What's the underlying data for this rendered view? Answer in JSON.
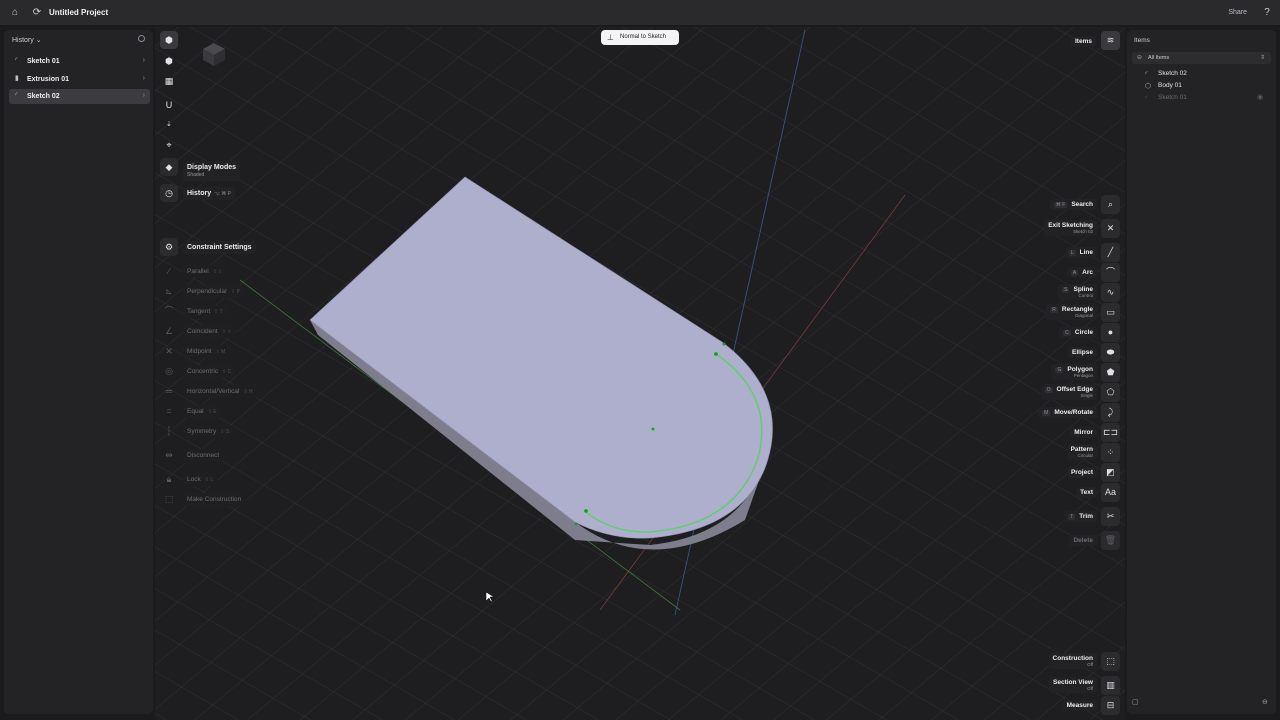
{
  "topbar": {
    "project_title": "Untitled Project",
    "share_label": "Share"
  },
  "history_panel": {
    "title": "History",
    "items": [
      {
        "label": "Sketch 01"
      },
      {
        "label": "Extrusion 01"
      },
      {
        "label": "Sketch 02",
        "selected": true
      }
    ]
  },
  "viewport": {
    "normal_to_sketch_label": "Normal to Sketch"
  },
  "left_tools": {
    "display_modes": {
      "label": "Display Modes",
      "sub": "Shaded"
    },
    "history": {
      "label": "History",
      "shortcut": "⌥ ⌘ P"
    },
    "constraint_settings": {
      "label": "Constraint Settings"
    },
    "constraints": [
      {
        "label": "Parallel",
        "shortcut": "⇧ ⇧"
      },
      {
        "label": "Perpendicular",
        "shortcut": "⇧ P"
      },
      {
        "label": "Tangent",
        "shortcut": "⇧ T"
      },
      {
        "label": "Coincident",
        "shortcut": "⇧ ⇧"
      },
      {
        "label": "Midpoint",
        "shortcut": "⇧ M"
      },
      {
        "label": "Concentric",
        "shortcut": "⇧ C"
      },
      {
        "label": "Horizontal/Vertical",
        "shortcut": "⇧ H"
      },
      {
        "label": "Equal",
        "shortcut": "⇧ E"
      },
      {
        "label": "Symmetry",
        "shortcut": "⇧ S"
      },
      {
        "label": "Disconnect",
        "shortcut": ""
      },
      {
        "label": "Lock",
        "shortcut": "⇧ L"
      },
      {
        "label": "Make Construction",
        "shortcut": ""
      }
    ]
  },
  "sketch_tools": [
    {
      "label": "Search",
      "shortcut": "⌘ F",
      "sub": ""
    },
    {
      "label": "Exit Sketching",
      "shortcut": "",
      "sub": "Sketch 02"
    },
    {
      "label": "Line",
      "shortcut": "L",
      "sub": ""
    },
    {
      "label": "Arc",
      "shortcut": "A",
      "sub": ""
    },
    {
      "label": "Spline",
      "shortcut": "S",
      "sub": "Control"
    },
    {
      "label": "Rectangle",
      "shortcut": "R",
      "sub": "Diagonal"
    },
    {
      "label": "Circle",
      "shortcut": "C",
      "sub": ""
    },
    {
      "label": "Ellipse",
      "shortcut": "",
      "sub": ""
    },
    {
      "label": "Polygon",
      "shortcut": "G",
      "sub": "Pentagon"
    },
    {
      "label": "Offset Edge",
      "shortcut": "O",
      "sub": "Single"
    },
    {
      "label": "Move/Rotate",
      "shortcut": "M",
      "sub": ""
    },
    {
      "label": "Mirror",
      "shortcut": "",
      "sub": ""
    },
    {
      "label": "Pattern",
      "shortcut": "",
      "sub": "Circular"
    },
    {
      "label": "Project",
      "shortcut": "",
      "sub": ""
    },
    {
      "label": "Text",
      "shortcut": "",
      "sub": ""
    },
    {
      "label": "Trim",
      "shortcut": "T",
      "sub": ""
    },
    {
      "label": "Delete",
      "shortcut": "",
      "sub": ""
    }
  ],
  "bottom_tools": [
    {
      "label": "Construction",
      "sub": "Off"
    },
    {
      "label": "Section View",
      "sub": "Off"
    },
    {
      "label": "Measure",
      "sub": ""
    }
  ],
  "items_panel": {
    "tab_label": "Items",
    "title": "Items",
    "filter": "All Items",
    "items": [
      {
        "label": "Sketch 02",
        "icon": "sketch-icon"
      },
      {
        "label": "Body 01",
        "icon": "body-icon"
      },
      {
        "label": "Sketch 01",
        "icon": "sketch-icon",
        "hidden": true
      }
    ]
  }
}
